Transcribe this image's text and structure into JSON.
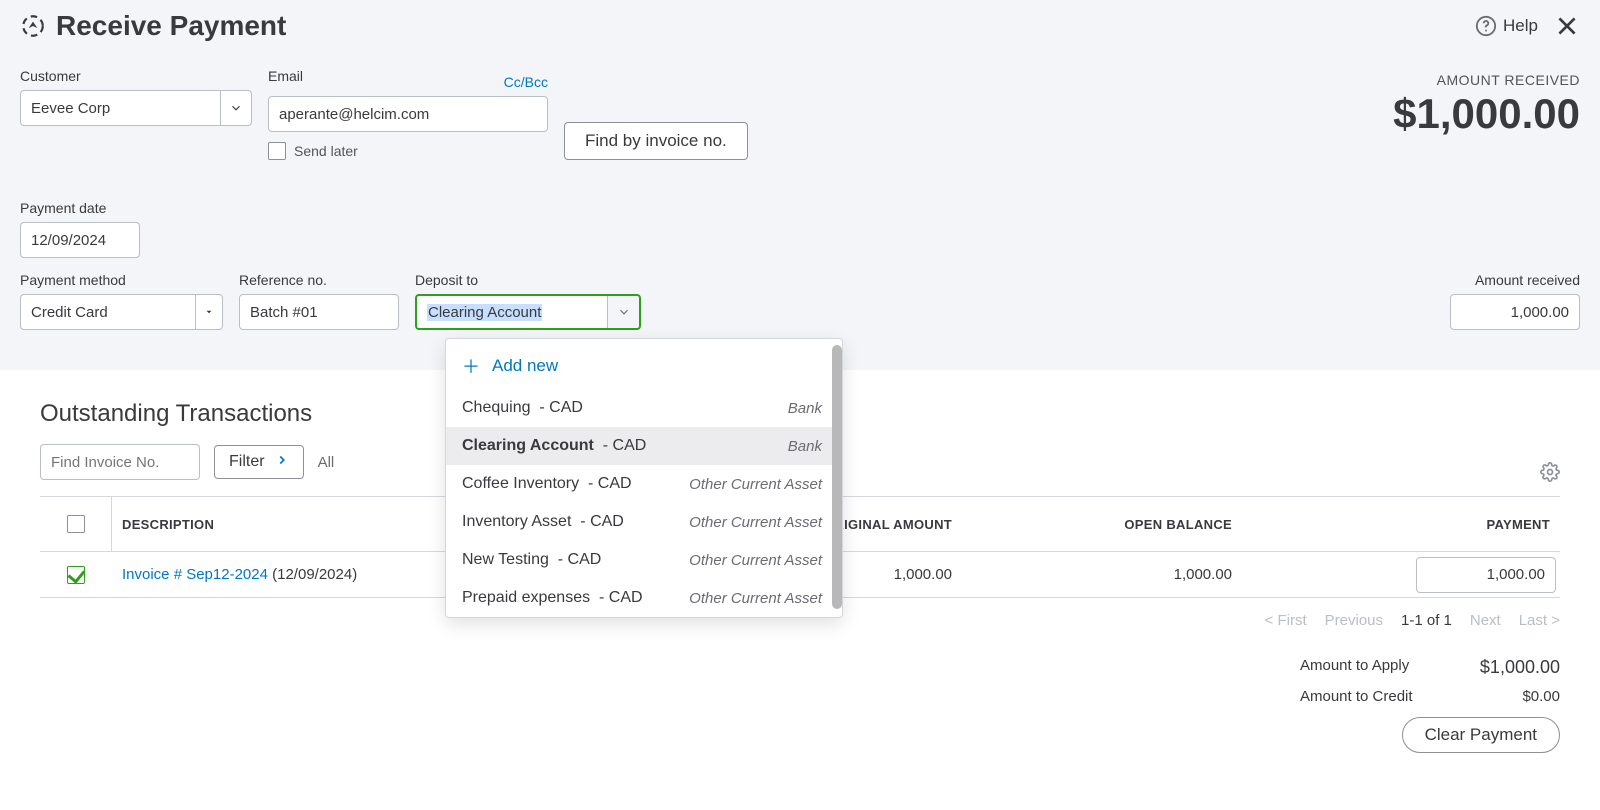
{
  "header": {
    "title": "Receive Payment",
    "help": "Help"
  },
  "customer": {
    "label": "Customer",
    "value": "Eevee Corp"
  },
  "email": {
    "label": "Email",
    "ccbcc": "Cc/Bcc",
    "value": "aperante@helcim.com",
    "send_later": "Send later"
  },
  "find_invoice_btn": "Find by invoice no.",
  "amount_received_display": {
    "label": "AMOUNT RECEIVED",
    "value": "$1,000.00"
  },
  "payment_date": {
    "label": "Payment date",
    "value": "12/09/2024"
  },
  "payment_method": {
    "label": "Payment method",
    "value": "Credit Card"
  },
  "reference": {
    "label": "Reference no.",
    "value": "Batch #01"
  },
  "deposit_to": {
    "label": "Deposit to",
    "value": "Clearing Account",
    "add_new": "Add new",
    "options": [
      {
        "name": "Chequing",
        "currency": "CAD",
        "type": "Bank"
      },
      {
        "name": "Clearing Account",
        "currency": "CAD",
        "type": "Bank",
        "selected": true
      },
      {
        "name": "Coffee Inventory",
        "currency": "CAD",
        "type": "Other Current Asset"
      },
      {
        "name": "Inventory Asset",
        "currency": "CAD",
        "type": "Other Current Asset"
      },
      {
        "name": "New Testing",
        "currency": "CAD",
        "type": "Other Current Asset"
      },
      {
        "name": "Prepaid expenses",
        "currency": "CAD",
        "type": "Other Current Asset"
      }
    ]
  },
  "amount_received_field": {
    "label": "Amount received",
    "value": "1,000.00"
  },
  "outstanding": {
    "title": "Outstanding Transactions",
    "find_placeholder": "Find Invoice No.",
    "filter": "Filter",
    "all": "All",
    "columns": {
      "description": "DESCRIPTION",
      "original": "ORIGINAL AMOUNT",
      "open": "OPEN BALANCE",
      "payment": "PAYMENT"
    },
    "rows": [
      {
        "link": "Invoice # Sep12-2024",
        "date": "(12/09/2024)",
        "original": "1,000.00",
        "open": "1,000.00",
        "payment": "1,000.00",
        "checked": true
      }
    ],
    "pager": {
      "first": "< First",
      "prev": "Previous",
      "range": "1-1 of 1",
      "next": "Next",
      "last": "Last >"
    }
  },
  "totals": {
    "apply_label": "Amount to Apply",
    "apply_value": "$1,000.00",
    "credit_label": "Amount to Credit",
    "credit_value": "$0.00",
    "clear_payment": "Clear Payment"
  }
}
